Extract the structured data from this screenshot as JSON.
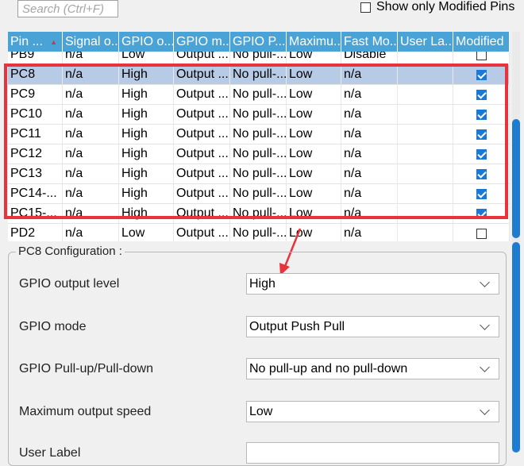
{
  "search": {
    "placeholder": "Search (Ctrl+F)"
  },
  "show_modified": {
    "label": "Show only Modified Pins",
    "checked": false
  },
  "table": {
    "columns": [
      "Pin ...",
      "Signal o...",
      "GPIO o...",
      "GPIO m...",
      "GPIO P...",
      "Maximu...",
      "Fast Mo...",
      "User La...",
      "Modified"
    ],
    "rows": [
      {
        "pin": "PB9",
        "signal": "n/a",
        "output": "Low",
        "mode": "Output ...",
        "pull": "No pull-...",
        "speed": "Low",
        "fast": "Disable",
        "label": "",
        "modified": false
      },
      {
        "pin": "PC8",
        "signal": "n/a",
        "output": "High",
        "mode": "Output ...",
        "pull": "No pull-...",
        "speed": "Low",
        "fast": "n/a",
        "label": "",
        "modified": true
      },
      {
        "pin": "PC9",
        "signal": "n/a",
        "output": "High",
        "mode": "Output ...",
        "pull": "No pull-...",
        "speed": "Low",
        "fast": "n/a",
        "label": "",
        "modified": true
      },
      {
        "pin": "PC10",
        "signal": "n/a",
        "output": "High",
        "mode": "Output ...",
        "pull": "No pull-...",
        "speed": "Low",
        "fast": "n/a",
        "label": "",
        "modified": true
      },
      {
        "pin": "PC11",
        "signal": "n/a",
        "output": "High",
        "mode": "Output ...",
        "pull": "No pull-...",
        "speed": "Low",
        "fast": "n/a",
        "label": "",
        "modified": true
      },
      {
        "pin": "PC12",
        "signal": "n/a",
        "output": "High",
        "mode": "Output ...",
        "pull": "No pull-...",
        "speed": "Low",
        "fast": "n/a",
        "label": "",
        "modified": true
      },
      {
        "pin": "PC13",
        "signal": "n/a",
        "output": "High",
        "mode": "Output ...",
        "pull": "No pull-...",
        "speed": "Low",
        "fast": "n/a",
        "label": "",
        "modified": true
      },
      {
        "pin": "PC14-...",
        "signal": "n/a",
        "output": "High",
        "mode": "Output ...",
        "pull": "No pull-...",
        "speed": "Low",
        "fast": "n/a",
        "label": "",
        "modified": true
      },
      {
        "pin": "PC15-...",
        "signal": "n/a",
        "output": "High",
        "mode": "Output ...",
        "pull": "No pull-...",
        "speed": "Low",
        "fast": "n/a",
        "label": "",
        "modified": true
      },
      {
        "pin": "PD2",
        "signal": "n/a",
        "output": "Low",
        "mode": "Output ...",
        "pull": "No pull-...",
        "speed": "Low",
        "fast": "n/a",
        "label": "",
        "modified": false
      }
    ]
  },
  "config": {
    "title": "PC8 Configuration :",
    "fields": [
      {
        "label": "GPIO output level",
        "value": "High"
      },
      {
        "label": "GPIO mode",
        "value": "Output Push Pull"
      },
      {
        "label": "GPIO Pull-up/Pull-down",
        "value": "No pull-up and no pull-down"
      },
      {
        "label": "Maximum output speed",
        "value": "Low"
      },
      {
        "label": "User Label",
        "value": ""
      }
    ]
  },
  "colors": {
    "header_bg": "#49a3d6",
    "selected_row": "#b7cbe6",
    "highlight_box": "#e8333c",
    "checkbox": "#1a78d6"
  }
}
